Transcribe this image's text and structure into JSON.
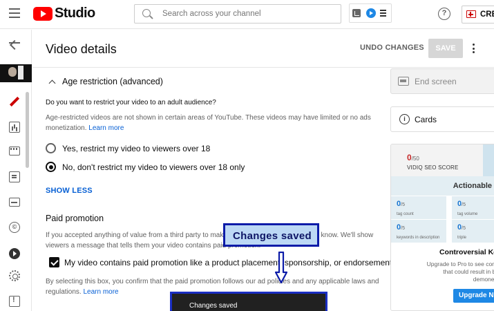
{
  "app": {
    "name": "Studio",
    "search_placeholder": "Search across your channel",
    "create_label": "CREA",
    "help_label": "?"
  },
  "header": {
    "title": "Video details",
    "undo_label": "UNDO CHANGES",
    "save_label": "SAVE"
  },
  "age_restriction": {
    "heading": "Age restriction (advanced)",
    "question": "Do you want to restrict your video to an adult audience?",
    "description": "Age-restricted videos are not shown in certain areas of YouTube. These videos may have limited or no ads monetization.",
    "learn_more": "Learn more",
    "option_yes": "Yes, restrict my video to viewers over 18",
    "option_no": "No, don't restrict my video to viewers over 18 only",
    "selected": "no",
    "show_less": "SHOW LESS"
  },
  "paid_promotion": {
    "heading": "Paid promotion",
    "description": "If you accepted anything of value from a third party to make your video, you have to let us know. We'll show viewers a message that tells them your video contains paid promotion.",
    "checkbox_label": "My video contains paid promotion like a product placement, sponsorship, or endorsement",
    "checked": true,
    "note": "By selecting this box, you confirm that the paid promotion follows our ad policies and any applicable laws and regulations.",
    "learn_more": "Learn more"
  },
  "right_panel": {
    "end_screen": "End screen",
    "cards": "Cards",
    "seo_score": "0",
    "seo_max": "/50",
    "seo_label": "VIDIQ SEO SCORE",
    "actionable": "Actionable",
    "metrics": [
      {
        "value": "0",
        "max": "/5",
        "label": "tag count"
      },
      {
        "value": "0",
        "max": "/5",
        "label": "tag volume"
      },
      {
        "value": "0",
        "max": "/5",
        "label": "keywords in description"
      },
      {
        "value": "0",
        "max": "/5",
        "label": "triple"
      }
    ],
    "controversial": "Controversial Ke",
    "upgrade_text": "Upgrade to Pro to see conte that could result in bei demonetiz",
    "upgrade_button": "Upgrade N"
  },
  "toast": {
    "message": "Changes saved"
  },
  "annotation": {
    "callout": "Changes saved",
    "accent_color": "#0b1ba8"
  },
  "colors": {
    "brand_red": "#ff0000",
    "link_blue": "#065fd4",
    "active_icon": "#cc0000"
  }
}
